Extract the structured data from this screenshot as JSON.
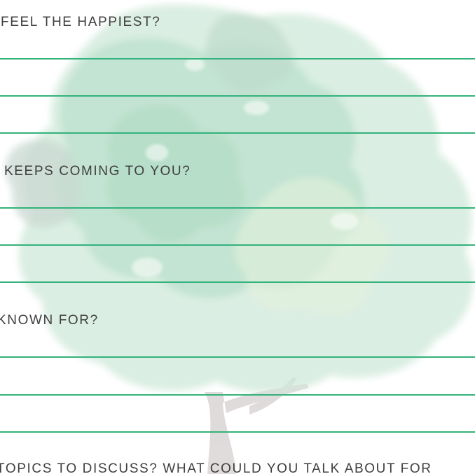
{
  "worksheet": {
    "questions": [
      "FEEL THE HAPPIEST?",
      "KEEPS COMING TO YOU?",
      "KNOWN FOR?",
      "TOPICS TO DISCUSS? WHAT COULD YOU TALK ABOUT FOR"
    ]
  },
  "colors": {
    "rule_green": "#34b27b",
    "text": "#3f3f3f",
    "tree_green": "#9fd3b6",
    "tree_trunk": "#ddd8d8"
  }
}
